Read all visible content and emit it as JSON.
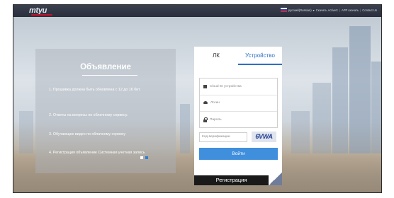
{
  "header": {
    "logo_text": "mtyu",
    "language": "русский(Russian)",
    "links": [
      "Скачать ActiveX",
      "APP скачать",
      "Contact Us"
    ]
  },
  "announcement": {
    "title": "Объявление",
    "items": [
      "1. Прошивка должна быть обновлена с 12 до 16 бит.",
      "2. Ответы на вопросы по облачному сервису.",
      "3. Обучающее видео по облачному сервису",
      "4. Регистрация объявление Системная учетная запись"
    ]
  },
  "login": {
    "tabs": [
      "ЛК",
      "Устройство"
    ],
    "active_tab": "Устройство",
    "fields": {
      "device_id_placeholder": "Cloud ID устройства",
      "login_placeholder": "Логин",
      "password_placeholder": "Пароль"
    },
    "verify_placeholder": "Код верификации",
    "captcha_text": "6VWA",
    "login_button": "Войти",
    "register_label": "Регистрация"
  },
  "colors": {
    "accent": "#3f8fdd",
    "topbar": "#2b2f3c"
  }
}
